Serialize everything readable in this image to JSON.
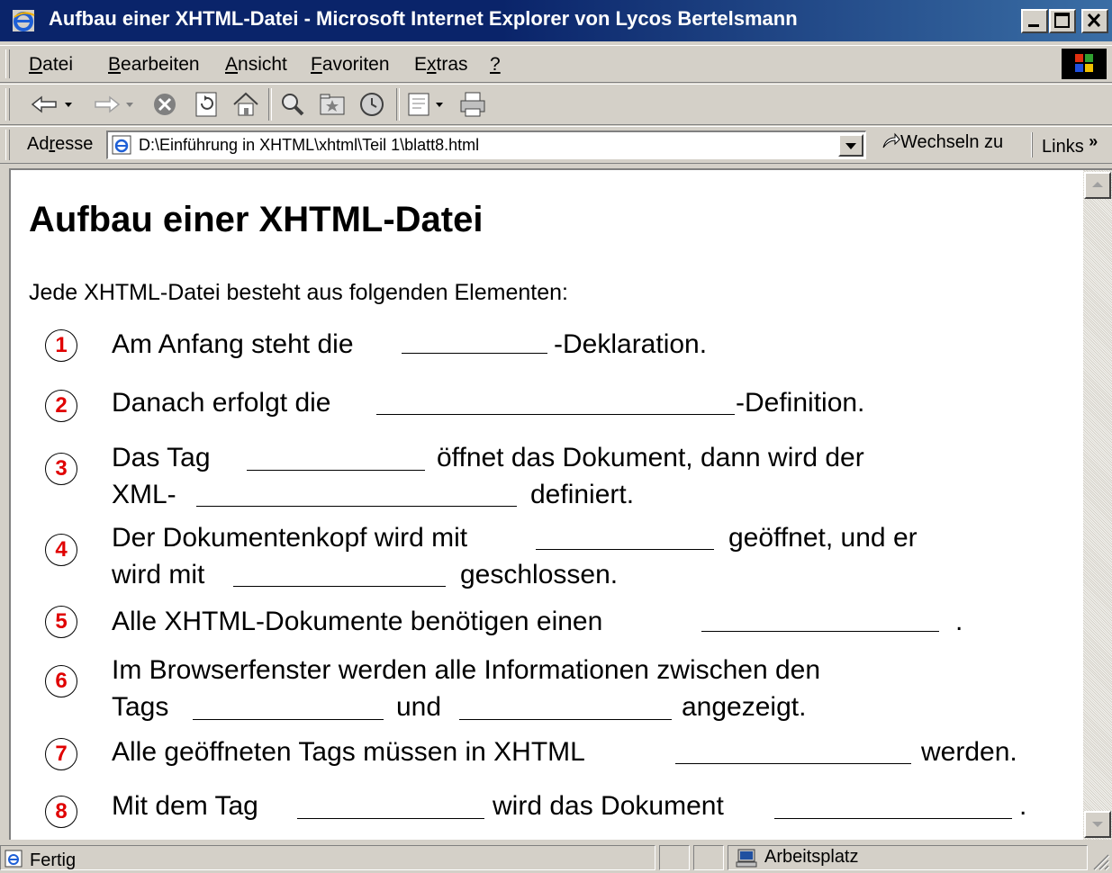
{
  "window": {
    "title": "Aufbau einer XHTML-Datei - Microsoft Internet Explorer von Lycos Bertelsmann"
  },
  "menu": {
    "items": [
      {
        "acc": "D",
        "rest": "atei"
      },
      {
        "acc": "B",
        "rest": "earbeiten"
      },
      {
        "acc": "A",
        "rest": "nsicht"
      },
      {
        "acc": "F",
        "rest": "avoriten"
      },
      {
        "pre": "E",
        "acc": "x",
        "rest": "tras"
      },
      {
        "acc": "?",
        "rest": ""
      }
    ]
  },
  "toolbar": {
    "icons": [
      "back-icon",
      "forward-icon",
      "stop-icon",
      "refresh-icon",
      "home-icon",
      "search-icon",
      "favorites-icon",
      "history-icon",
      "mail-icon",
      "print-icon"
    ]
  },
  "address": {
    "label_pre": "Ad",
    "label_acc": "r",
    "label_rest": "esse",
    "url": "D:\\Einführung in XHTML\\xhtml\\Teil 1\\blatt8.html",
    "go_label": "Wechseln zu",
    "links_label": "Links",
    "links_chevron": "»"
  },
  "page": {
    "heading": "Aufbau einer XHTML-Datei",
    "intro": "Jede XHTML-Datei besteht aus folgenden Elementen:",
    "items": [
      {
        "num": "1",
        "line1_a": "Am Anfang steht die",
        "line1_b": "-Deklaration."
      },
      {
        "num": "2",
        "line1_a": "Danach erfolgt die",
        "line1_b": "-Definition."
      },
      {
        "num": "3",
        "line1_a": "Das Tag",
        "line1_b": "öffnet das Dokument, dann wird der",
        "line2_a": "XML-",
        "line2_b": "definiert."
      },
      {
        "num": "4",
        "line1_a": "Der Dokumentenkopf wird mit",
        "line1_b": "geöffnet, und er",
        "line2_a": "wird mit",
        "line2_b": "geschlossen."
      },
      {
        "num": "5",
        "line1_a": "Alle XHTML-Dokumente benötigen einen",
        "line1_b": "."
      },
      {
        "num": "6",
        "line1_a": "Im Browserfenster werden alle Informationen zwischen den",
        "line2_a": "Tags",
        "line2_b": "und",
        "line2_c": "angezeigt."
      },
      {
        "num": "7",
        "line1_a": "Alle geöffneten Tags müssen in XHTML",
        "line1_b": "werden."
      },
      {
        "num": "8",
        "line1_a": "Mit dem Tag",
        "line1_b": "wird das Dokument",
        "line1_c": "."
      }
    ]
  },
  "status": {
    "text": "Fertig",
    "zone": "Arbeitsplatz"
  },
  "colors": {
    "titlebar": "#0a246a",
    "chrome": "#d4d0c8",
    "number_red": "#e00000"
  }
}
